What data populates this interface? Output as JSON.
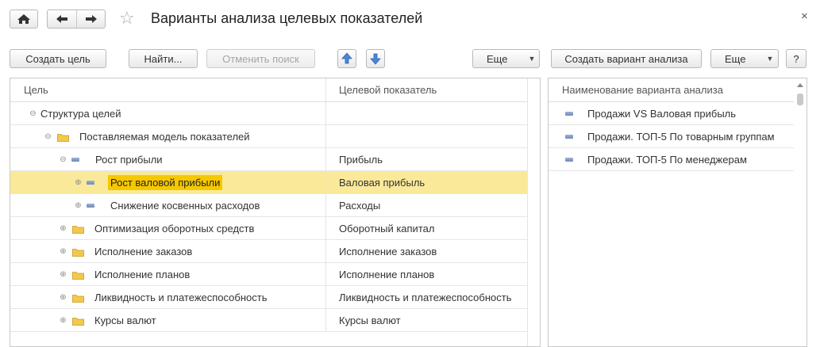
{
  "window": {
    "title": "Варианты анализа целевых показателей",
    "close_glyph": "×",
    "star_glyph": "☆"
  },
  "toolbar": {
    "create_goal": "Создать цель",
    "find": "Найти...",
    "cancel_search": "Отменить поиск",
    "more": "Еще",
    "create_variant": "Создать вариант анализа",
    "more2": "Еще",
    "help": "?"
  },
  "left_table": {
    "columns": [
      "Цель",
      "Целевой показатель"
    ],
    "rows": [
      {
        "name": "Структура целей",
        "indicator": "",
        "level": 0,
        "expander": "minus",
        "icon": "none"
      },
      {
        "name": "Поставляемая модель показателей",
        "indicator": "",
        "level": 1,
        "expander": "minus",
        "icon": "folder"
      },
      {
        "name": "Рост прибыли",
        "indicator": "Прибыль",
        "level": 2,
        "expander": "minus",
        "icon": "dash"
      },
      {
        "name": "Рост валовой прибыли",
        "indicator": "Валовая прибыль",
        "level": 3,
        "expander": "plus",
        "icon": "dash",
        "selected": true
      },
      {
        "name": "Снижение косвенных расходов",
        "indicator": "Расходы",
        "level": 3,
        "expander": "plus",
        "icon": "dash"
      },
      {
        "name": "Оптимизация оборотных средств",
        "indicator": "Оборотный капитал",
        "level": 2,
        "expander": "plus",
        "icon": "folder"
      },
      {
        "name": "Исполнение заказов",
        "indicator": "Исполнение заказов",
        "level": 2,
        "expander": "plus",
        "icon": "folder"
      },
      {
        "name": "Исполнение планов",
        "indicator": "Исполнение планов",
        "level": 2,
        "expander": "plus",
        "icon": "folder"
      },
      {
        "name": "Ликвидность и платежеспособность",
        "indicator": "Ликвидность и платежеспособность",
        "level": 2,
        "expander": "plus",
        "icon": "folder"
      },
      {
        "name": "Курсы валют",
        "indicator": "Курсы валют",
        "level": 2,
        "expander": "plus",
        "icon": "folder"
      }
    ]
  },
  "right_table": {
    "columns": [
      "Наименование варианта анализа"
    ],
    "rows": [
      {
        "name": "Продажи VS Валовая прибыль"
      },
      {
        "name": "Продажи. ТОП-5 По товарным группам"
      },
      {
        "name": "Продажи. ТОП-5 По менеджерам"
      }
    ]
  },
  "colors": {
    "selected_row": "#fbe99a",
    "highlight": "#f5c800",
    "folder": "#f2c94c",
    "arrow_blue": "#4a86d6"
  }
}
